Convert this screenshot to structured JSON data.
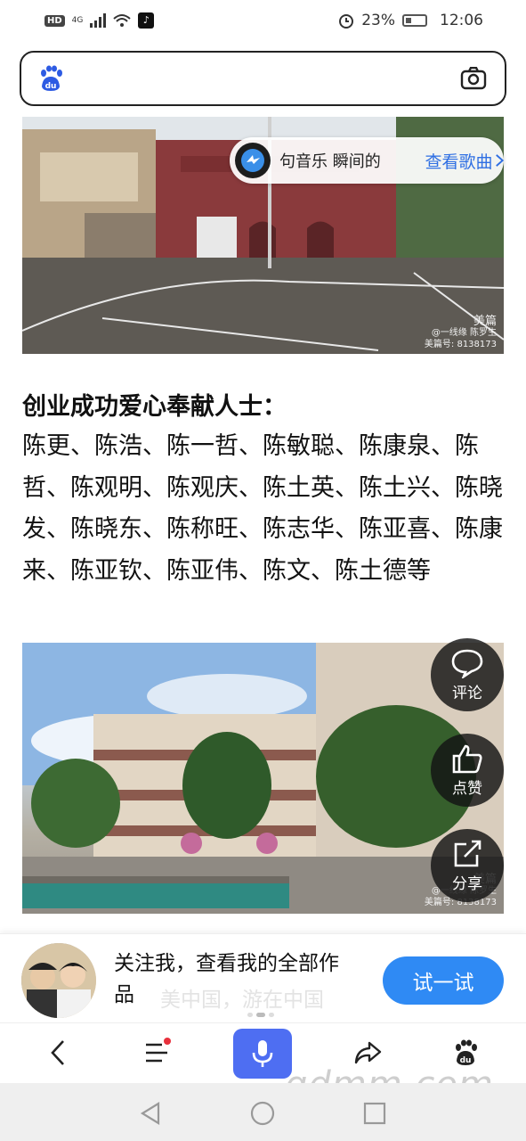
{
  "status": {
    "hd": "HD",
    "network": "4G",
    "battery": "23%",
    "time": "12:06"
  },
  "search": {
    "logo_text": "du",
    "icons": [
      "baidu-paw-icon",
      "camera-icon"
    ]
  },
  "photo1": {
    "watermark_brand": "美篇",
    "watermark_author": "@一线缘 陈罗生",
    "watermark_id": "美篇号: 8138173"
  },
  "music": {
    "text": "句音乐    瞬间的",
    "link": "查看歌曲"
  },
  "article": {
    "heading": "创业成功爱心奉献人士：",
    "body": "陈更、陈浩、陈一哲、陈敏聪、陈康泉、陈哲、陈观明、陈观庆、陈土英、陈土兴、陈晓发、陈晓东、陈称旺、陈志华、陈亚喜、陈康来、陈亚钦、陈亚伟、陈文、陈土德等"
  },
  "photo2": {
    "watermark_brand": "美篇",
    "watermark_author": "@一线缘 陈罗生",
    "watermark_id": "美篇号: 8138173"
  },
  "fab": {
    "comment": "评论",
    "like": "点赞",
    "share": "分享"
  },
  "follow": {
    "text": "关注我，查看我的全部作品",
    "ghost": "美中国，游在中国",
    "button": "试一试"
  },
  "toolbar": {
    "icons": [
      "back-icon",
      "menu-icon",
      "microphone-icon",
      "share-arrow-icon",
      "baidu-paw-icon"
    ],
    "accent": "#4e6ef2"
  },
  "watermark": {
    "site": "gdmm.com"
  }
}
